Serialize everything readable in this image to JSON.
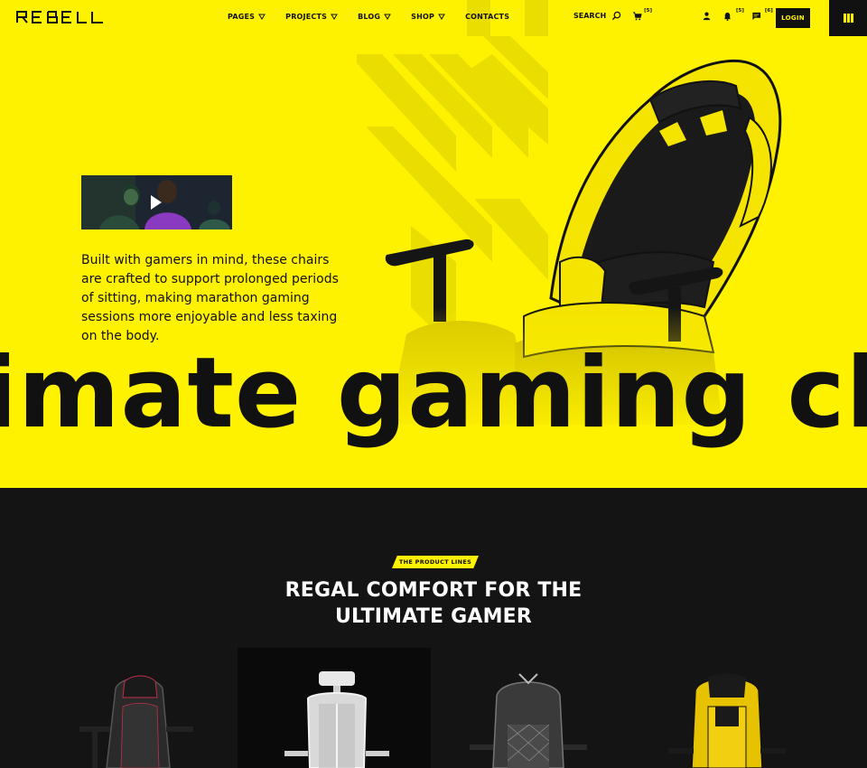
{
  "header": {
    "logo_text": "REBELL",
    "nav": [
      {
        "label": "PAGES",
        "has_dropdown": true
      },
      {
        "label": "PROJECTS",
        "has_dropdown": true
      },
      {
        "label": "BLOG",
        "has_dropdown": true
      },
      {
        "label": "SHOP",
        "has_dropdown": true
      },
      {
        "label": "CONTACTS",
        "has_dropdown": false
      }
    ],
    "search_label": "SEARCH",
    "cart_count": "[5]",
    "notifications_count": "[5]",
    "messages_count": "[6]",
    "login_label": "LOGIN",
    "icons": [
      "search-icon",
      "cart-icon",
      "user-icon",
      "bell-icon",
      "chat-icon",
      "grid-menu-icon"
    ]
  },
  "hero": {
    "description": "Built with gamers in mind, these chairs are crafted to support prolonged periods of sitting, making marathon gaming sessions more enjoyable and less taxing on the body.",
    "marquee_text": "imate gaming chairs",
    "video_icon": "play-icon"
  },
  "products": {
    "tag": "THE PRODUCT LINES",
    "title_line1": "REGAL COMFORT FOR THE",
    "title_line2": "ULTIMATE GAMER"
  },
  "colors": {
    "accent": "#fff200",
    "dark": "#141414",
    "black": "#111111"
  }
}
